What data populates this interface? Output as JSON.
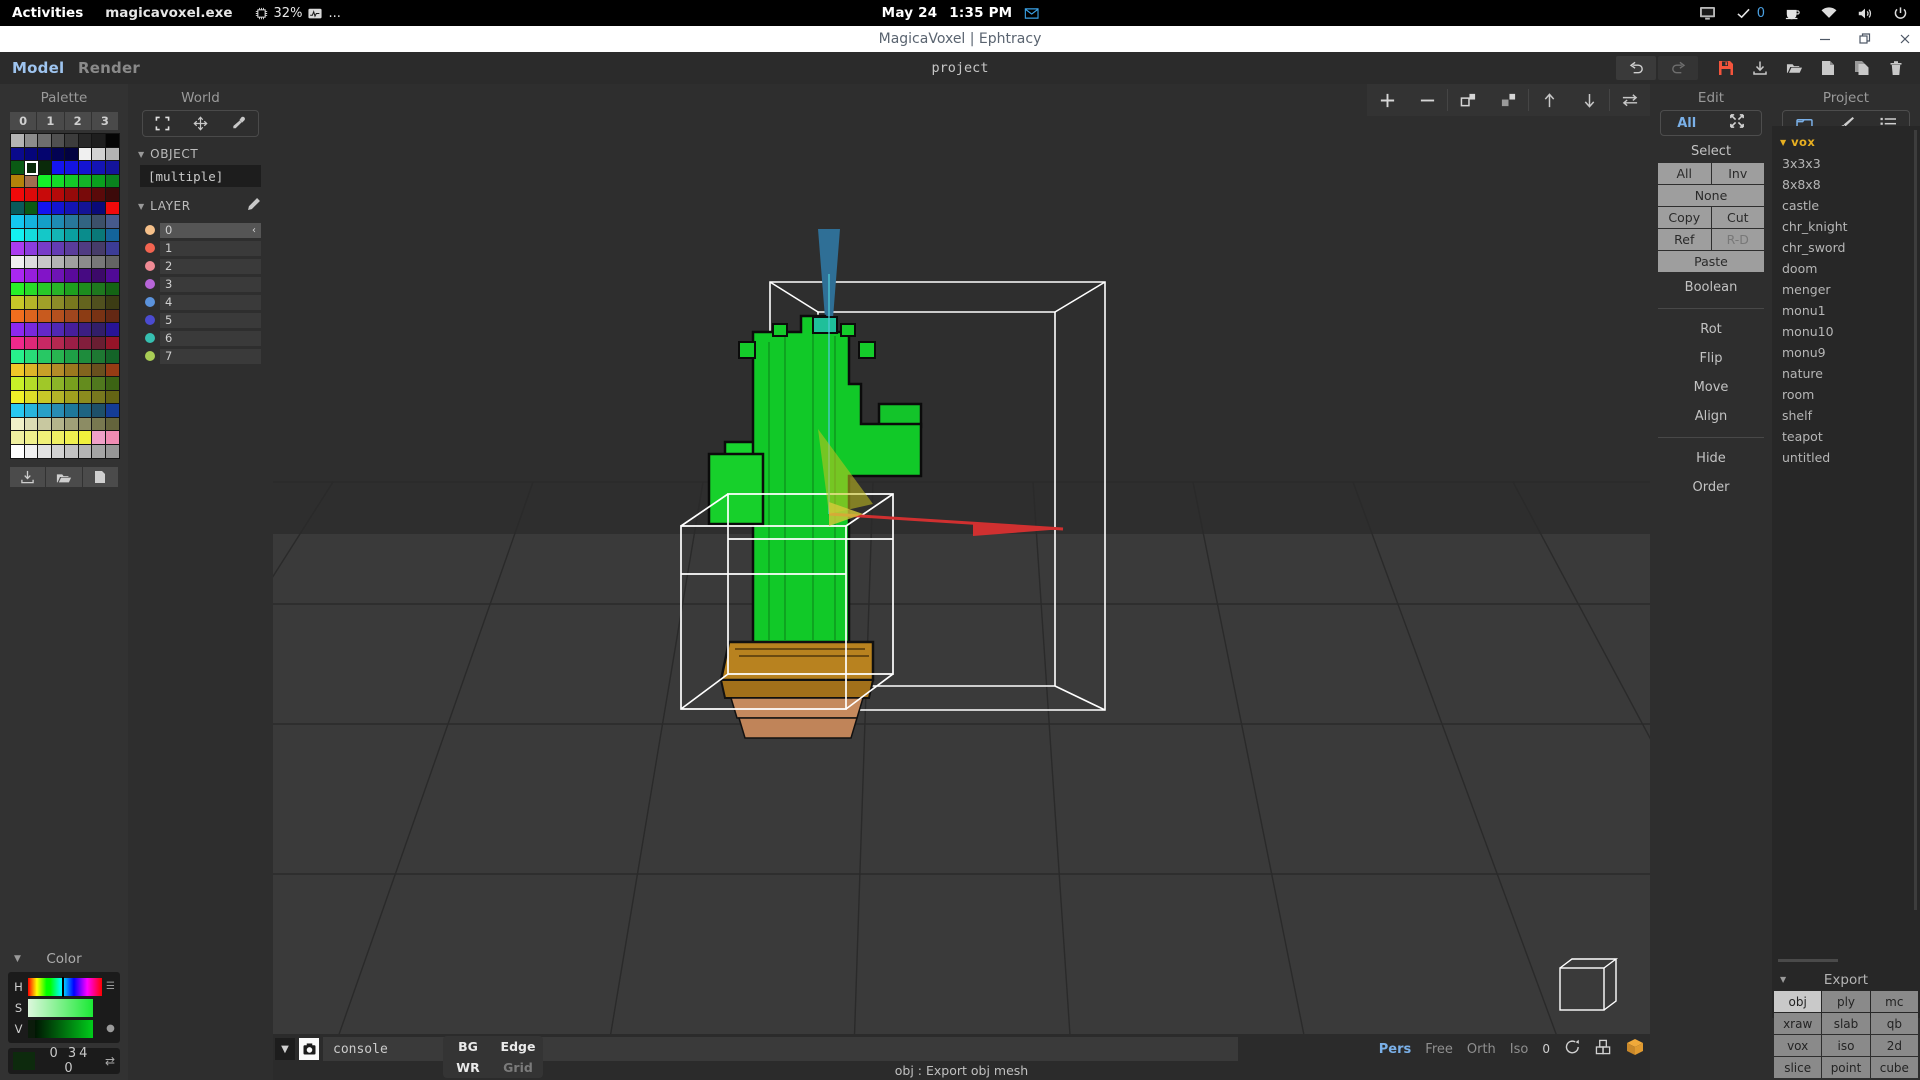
{
  "gnome": {
    "activities": "Activities",
    "app_name": "magicavoxel.exe",
    "cpu_percent": "32%",
    "overflow": "...",
    "date": "May 24",
    "time": "1:35 PM",
    "tray_count": "0",
    "icons": [
      "cpu-icon",
      "activity-graph-icon",
      "mail-icon",
      "display-icon",
      "check-icon",
      "coffee-icon",
      "wifi-icon",
      "volume-icon",
      "power-icon"
    ]
  },
  "window": {
    "title": "MagicaVoxel | Ephtracy",
    "controls": [
      "minimize-icon",
      "maximize-icon",
      "close-icon"
    ]
  },
  "menu": {
    "model": "Model",
    "render": "Render",
    "project_name": "project",
    "toolbar_icons": [
      "undo-icon",
      "redo-icon",
      "save-icon",
      "download-icon",
      "open-folder-icon",
      "new-file-icon",
      "copy-file-icon",
      "trash-icon"
    ]
  },
  "palette": {
    "title": "Palette",
    "tabs": [
      "0",
      "1",
      "2",
      "3"
    ],
    "selected_index": 17,
    "colors": [
      "#b4b4b4",
      "#8c8c8c",
      "#6e6e6e",
      "#505050",
      "#3c3c3c",
      "#282828",
      "#1e1e1e",
      "#050505",
      "#0a0a8c",
      "#05057a",
      "#04046e",
      "#030352",
      "#020240",
      "#f0f0f0",
      "#d2d2d2",
      "#b4b4b4",
      "#0a5a14",
      "#0a2a0a",
      "#0a2a0a",
      "#1414f0",
      "#1414e1",
      "#1414d2",
      "#1414b4",
      "#14149b",
      "#b4820a",
      "#a06e50",
      "#14f028",
      "#14dc28",
      "#14c828",
      "#14b428",
      "#0aa01e",
      "#0a821e",
      "#f00a0a",
      "#dc0a0a",
      "#c80a0a",
      "#b40a0a",
      "#960a0a",
      "#780a0a",
      "#5a0a0a",
      "#3c0a0a",
      "#0a5a5a",
      "#0a5a14",
      "#1414f0",
      "#1414d2",
      "#1414b4",
      "#141496",
      "#0a0a78",
      "#f00a0a",
      "#14c8f0",
      "#14b4dc",
      "#14a0c8",
      "#1e8cb4",
      "#28789b",
      "#326482",
      "#3c5069",
      "#465a8c",
      "#14f0f0",
      "#14dcdc",
      "#14c8c8",
      "#14b4b4",
      "#0aa0a0",
      "#0a8c8c",
      "#0a7878",
      "#14649b",
      "#aa3cf0",
      "#8c3cdc",
      "#783cc8",
      "#643cb4",
      "#5a3c9b",
      "#503c82",
      "#463c69",
      "#3c3c96",
      "#f0f0f0",
      "#dcdcdc",
      "#c8c8c8",
      "#b4b4b4",
      "#a0a0a0",
      "#8c8c8c",
      "#787878",
      "#646464",
      "#aa28f0",
      "#961edc",
      "#8214c8",
      "#6e14b4",
      "#5a0a9b",
      "#460a82",
      "#3c0a69",
      "#500a96",
      "#28f028",
      "#28dc28",
      "#28c828",
      "#28b428",
      "#1ea01e",
      "#1e8c1e",
      "#1e781e",
      "#146414",
      "#c8c828",
      "#b4b428",
      "#a0a028",
      "#8c8c28",
      "#78781e",
      "#64641e",
      "#50501e",
      "#3c3c14",
      "#f06e1e",
      "#dc641e",
      "#c85a1e",
      "#b4501e",
      "#a0461e",
      "#8c3c14",
      "#783214",
      "#642814",
      "#8c28f0",
      "#7828dc",
      "#6428c8",
      "#5028b4",
      "#461e9b",
      "#3c1e82",
      "#321e69",
      "#281496",
      "#f0288c",
      "#dc2878",
      "#c82864",
      "#b42850",
      "#9b1e46",
      "#821e3c",
      "#691e32",
      "#961428",
      "#28f08c",
      "#28dc78",
      "#28c864",
      "#28b450",
      "#1ea046",
      "#1e8c3c",
      "#1e7832",
      "#146428",
      "#f0c828",
      "#dcb428",
      "#c8a028",
      "#b48c28",
      "#9b781e",
      "#82641e",
      "#69501e",
      "#963c14",
      "#c8f028",
      "#b4dc28",
      "#a0c828",
      "#8cb428",
      "#78a01e",
      "#648c1e",
      "#50781e",
      "#3c6414",
      "#f0f028",
      "#dcdc28",
      "#c8c828",
      "#b4b428",
      "#a0a01e",
      "#8c8c1e",
      "#78781e",
      "#646414",
      "#28c8f0",
      "#28b4dc",
      "#28a0c8",
      "#288cb4",
      "#1e789b",
      "#1e6482",
      "#1e5069",
      "#143c96",
      "#f0f0c8",
      "#dcdcb4",
      "#c8c8a0",
      "#b4b48c",
      "#a0a078",
      "#8c8c64",
      "#787850",
      "#64643c",
      "#f0f0a0",
      "#f0f08c",
      "#f0f078",
      "#f0f064",
      "#f0f050",
      "#f0f03c",
      "#f0a0c8",
      "#f08cb4",
      "#ffffff",
      "#f0f0f0",
      "#e1e1e1",
      "#d2d2d2",
      "#c3c3c3",
      "#b4b4b4",
      "#a5a5a5",
      "#969696"
    ],
    "actions": [
      "import-palette-icon",
      "open-palette-icon",
      "new-palette-icon"
    ]
  },
  "color": {
    "title": "Color",
    "channels": [
      "H",
      "S",
      "V"
    ],
    "values": "0  34  0",
    "swap_icon": "swap-icon",
    "menu_icon": "menu-icon",
    "dot_icon": "dot-icon"
  },
  "world": {
    "title": "World",
    "tools": [
      "select-frame-icon",
      "move-icon",
      "eyedropper-icon"
    ],
    "object_section": "OBJECT",
    "object_value": "[multiple]",
    "layer_section": "LAYER",
    "layer_edit_icon": "pencil-icon",
    "layers": [
      {
        "name": "0",
        "color": "#f5c08a",
        "selected": true,
        "right": "‹"
      },
      {
        "name": "1",
        "color": "#f26450",
        "selected": false,
        "right": ""
      },
      {
        "name": "2",
        "color": "#ef8a94",
        "selected": false,
        "right": ""
      },
      {
        "name": "3",
        "color": "#b765d8",
        "selected": false,
        "right": ""
      },
      {
        "name": "4",
        "color": "#5b93dd",
        "selected": false,
        "right": ""
      },
      {
        "name": "5",
        "color": "#4b4bd0",
        "selected": false,
        "right": ""
      },
      {
        "name": "6",
        "color": "#36bfb0",
        "selected": false,
        "right": ""
      },
      {
        "name": "7",
        "color": "#a8cc55",
        "selected": false,
        "right": ""
      }
    ]
  },
  "viewport": {
    "toolbar_icons": [
      "plus-icon",
      "minus-icon",
      "attach-icon",
      "detach-icon",
      "up-arrow-icon",
      "down-arrow-icon",
      "swap-arrows-icon"
    ],
    "console_placeholder": "console",
    "console_dropdown_icon": "chevron-down-icon",
    "camera_icon": "camera-icon",
    "camera_modes": [
      {
        "label": "Pers",
        "active": true
      },
      {
        "label": "Free",
        "active": false
      },
      {
        "label": "Orth",
        "active": false
      },
      {
        "label": "Iso",
        "active": false
      }
    ],
    "camera_index": "0",
    "rotate_icon": "rotate-icon",
    "grid3d_icon": "grid-3d-icon",
    "box_icon": "orange-box-icon",
    "status_text": "obj : Export obj mesh",
    "display_toggles": [
      {
        "label": "BG",
        "on": true
      },
      {
        "label": "Edge",
        "on": true
      },
      {
        "label": "WR",
        "on": true
      },
      {
        "label": "Grid",
        "on": false
      }
    ]
  },
  "edit": {
    "title": "Edit",
    "mode_label": "All",
    "expand_icon": "expand-icon",
    "select_label": "Select",
    "buttons": [
      [
        {
          "label": "All",
          "disabled": false
        },
        {
          "label": "Inv",
          "disabled": false
        }
      ],
      [
        {
          "label": "None",
          "disabled": false
        }
      ],
      [
        {
          "label": "Copy",
          "disabled": false
        },
        {
          "label": "Cut",
          "disabled": false
        }
      ],
      [
        {
          "label": "Ref",
          "disabled": false
        },
        {
          "label": "R-D",
          "disabled": true
        }
      ],
      [
        {
          "label": "Paste",
          "disabled": false
        }
      ]
    ],
    "boolean_label": "Boolean",
    "transform_links": [
      "Rot",
      "Flip",
      "Move",
      "Align"
    ],
    "visibility_links": [
      "Hide",
      "Order"
    ]
  },
  "project": {
    "title": "Project",
    "tools": [
      "folder-icon",
      "brush-icon",
      "list-icon"
    ],
    "group_label": "vox",
    "files": [
      "3x3x3",
      "8x8x8",
      "castle",
      "chr_knight",
      "chr_sword",
      "doom",
      "menger",
      "monu1",
      "monu10",
      "monu9",
      "nature",
      "room",
      "shelf",
      "teapot",
      "untitled"
    ],
    "export": {
      "title": "Export",
      "selected": "obj",
      "formats": [
        "obj",
        "ply",
        "mc",
        "xraw",
        "slab",
        "qb",
        "vox",
        "iso",
        "2d",
        "slice",
        "point",
        "cube"
      ]
    }
  }
}
